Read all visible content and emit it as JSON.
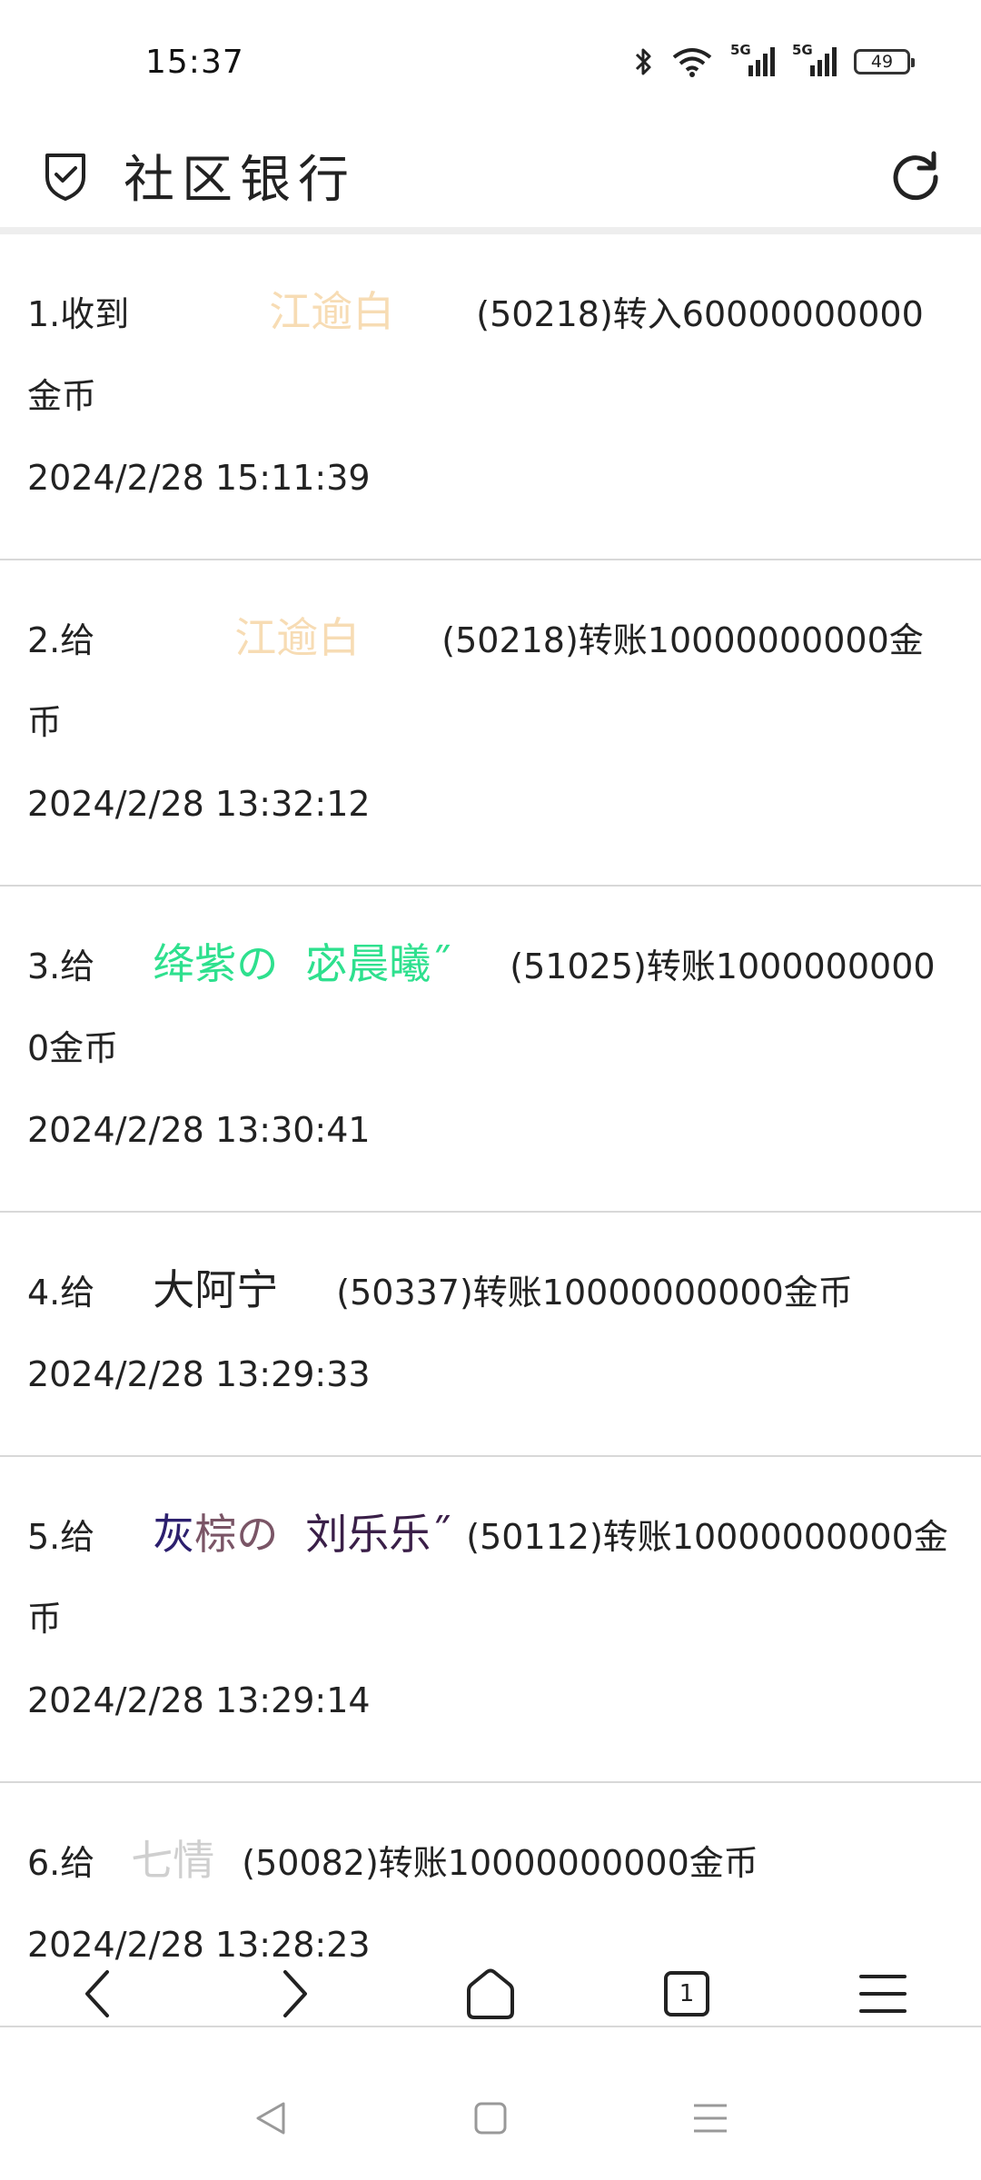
{
  "status": {
    "time": "15:37",
    "net_label_1": "5G",
    "net_label_2": "5G",
    "battery": "49"
  },
  "header": {
    "title": "社区银行"
  },
  "icons": {
    "shield": "shield-check-icon",
    "refresh": "refresh-icon",
    "back": "chevron-left-icon",
    "forward": "chevron-right-icon",
    "home": "home-icon",
    "tabs": "tabs-icon",
    "menu": "menu-icon"
  },
  "nav": {
    "tab_count": "1"
  },
  "transactions": [
    {
      "prefix": "1.收到",
      "name_a": "江逾白",
      "name_b": "",
      "detail": "(50218)转入60000000000金币",
      "date": "2024/2/28 15:11:39"
    },
    {
      "prefix": "2.给",
      "name_a": "江逾白",
      "name_b": "",
      "detail": "(50218)转账10000000000金币",
      "date": "2024/2/28 13:32:12"
    },
    {
      "prefix": "3.给",
      "name_a": "绛紫の",
      "name_b": "宓晨曦˝",
      "detail": "(51025)转账10000000000金币",
      "date": "2024/2/28 13:30:41"
    },
    {
      "prefix": "4.给",
      "name_a": "大阿宁",
      "name_b": "",
      "detail": "(50337)转账10000000000金币",
      "date": "2024/2/28 13:29:33"
    },
    {
      "prefix": "5.给",
      "name_a1": "灰",
      "name_a2": "棕の",
      "name_b": "刘乐乐˝",
      "detail": "(50112)转账10000000000金币",
      "date": "2024/2/28 13:29:14"
    },
    {
      "prefix": "6.给",
      "name_a": "七情",
      "name_b": "",
      "detail": "(50082)转账10000000000金币",
      "date": "2024/2/28 13:28:23"
    }
  ],
  "colors": {
    "name_peach": "#f7dcb4",
    "name_green": "#2ee08e",
    "name_dark": "#222222",
    "name_navy": "#2c1f6e",
    "name_mauve": "#7a5566",
    "name_plum": "#3a1f48",
    "name_gray": "#cfcfcf"
  }
}
